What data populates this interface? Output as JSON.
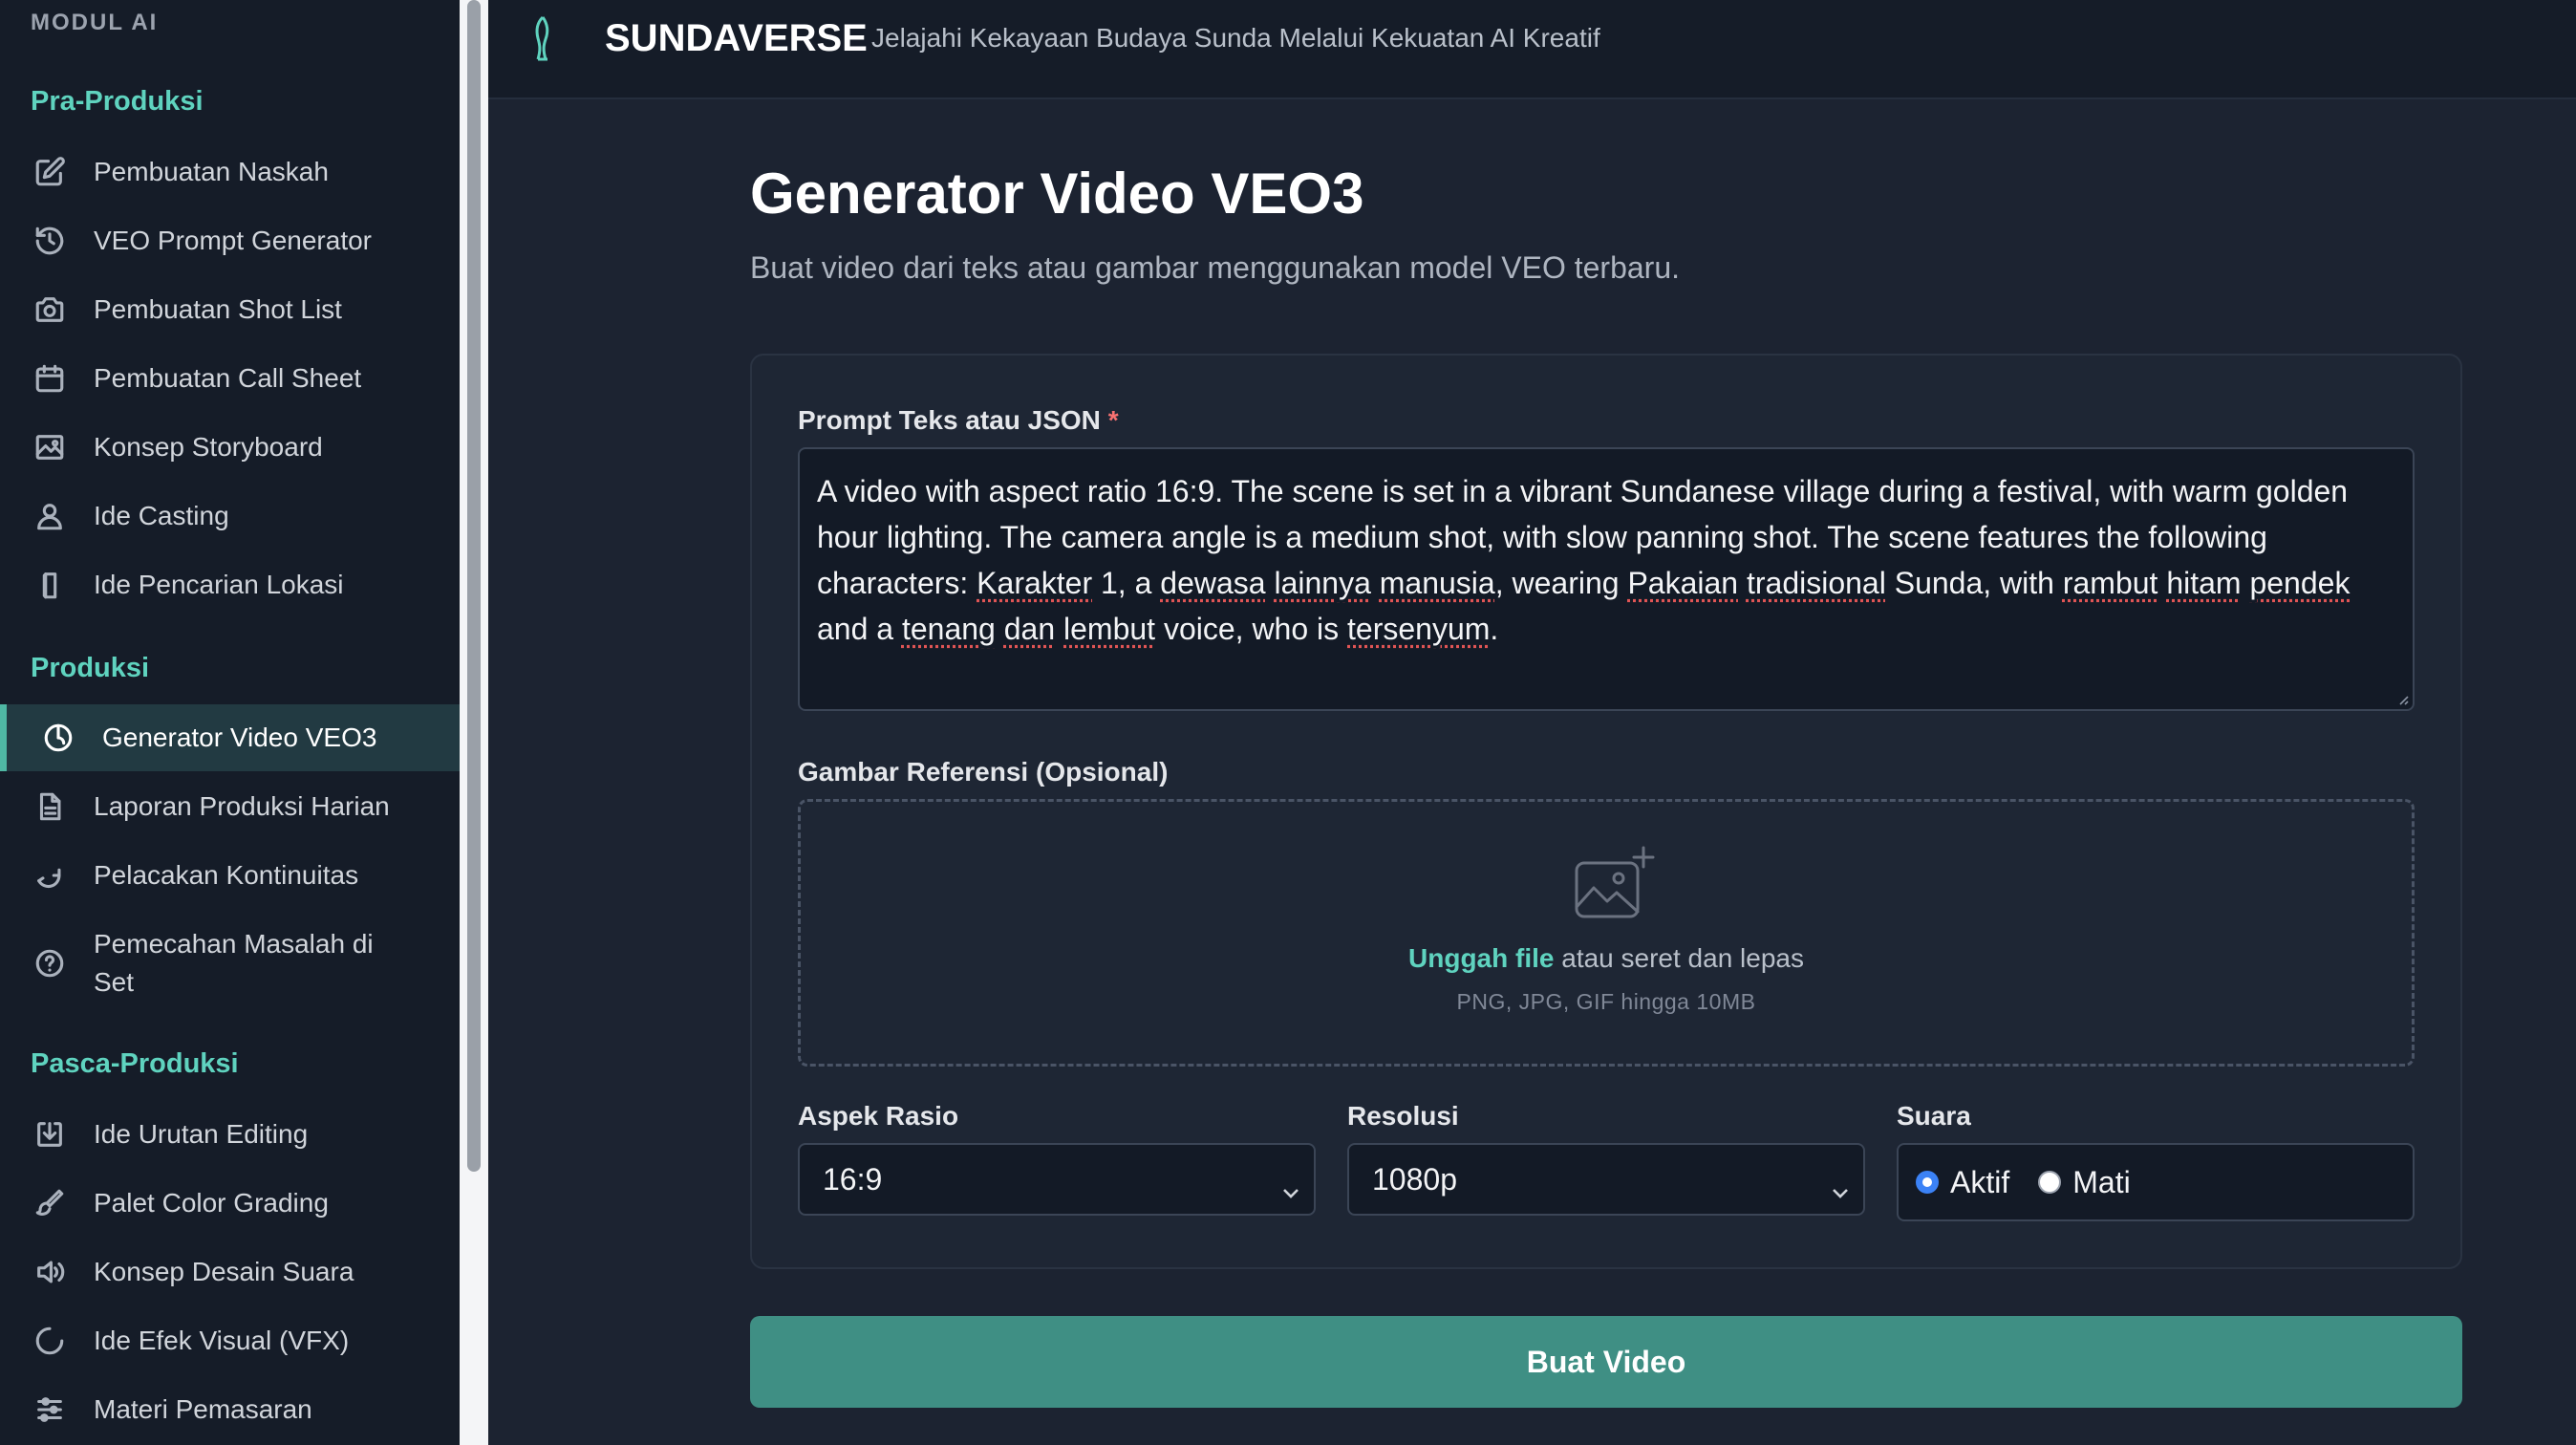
{
  "sidebar": {
    "modul_label": "MODUL AI",
    "sections": [
      {
        "title": "Pra-Produksi",
        "items": [
          {
            "label": "Pembuatan Naskah",
            "icon": "edit-icon"
          },
          {
            "label": "VEO Prompt Generator",
            "icon": "history-icon"
          },
          {
            "label": "Pembuatan Shot List",
            "icon": "camera-icon"
          },
          {
            "label": "Pembuatan Call Sheet",
            "icon": "calendar-icon"
          },
          {
            "label": "Konsep Storyboard",
            "icon": "image-icon"
          },
          {
            "label": "Ide Casting",
            "icon": "user-icon"
          },
          {
            "label": "Ide Pencarian Lokasi",
            "icon": "door-icon"
          }
        ]
      },
      {
        "title": "Produksi",
        "items": [
          {
            "label": "Generator Video VEO3",
            "icon": "power-icon",
            "active": true
          },
          {
            "label": "Laporan Produksi Harian",
            "icon": "document-icon"
          },
          {
            "label": "Pelacakan Kontinuitas",
            "icon": "return-arrow-icon"
          },
          {
            "label": "Pemecahan Masalah di Set",
            "icon": "help-circle-icon"
          }
        ]
      },
      {
        "title": "Pasca-Produksi",
        "items": [
          {
            "label": "Ide Urutan Editing",
            "icon": "import-icon"
          },
          {
            "label": "Palet Color Grading",
            "icon": "brush-icon"
          },
          {
            "label": "Konsep Desain Suara",
            "icon": "speaker-icon"
          },
          {
            "label": "Ide Efek Visual (VFX)",
            "icon": "spinner-circle-icon"
          },
          {
            "label": "Materi Pemasaran",
            "icon": "sliders-icon"
          }
        ]
      }
    ]
  },
  "header": {
    "brand": "SUNDAVERSE",
    "tagline": "Jelajahi Kekayaan Budaya Sunda Melalui Kekuatan AI Kreatif",
    "logo_icon": "kujang-logo-icon"
  },
  "main": {
    "title": "Generator Video VEO3",
    "subtitle": "Buat video dari teks atau gambar menggunakan model VEO terbaru.",
    "prompt": {
      "label": "Prompt Teks atau JSON",
      "required_mark": "*",
      "value_segments": [
        "A video with aspect ratio 16:9. The scene is set in a vibrant Sundanese village during a festival, with warm golden hour lighting. The camera angle is a medium shot, with slow panning shot. The scene features the following characters: ",
        "Karakter",
        " 1, a ",
        "dewasa",
        " ",
        "lainnya",
        " ",
        "manusia",
        ", wearing ",
        "Pakaian",
        " ",
        "tradisional",
        " Sunda, with ",
        "rambut",
        " ",
        "hitam",
        " ",
        "pendek",
        " and a ",
        "tenang",
        " ",
        "dan",
        " ",
        "lembut",
        " voice, who is ",
        "tersenyum",
        "."
      ]
    },
    "reference_image": {
      "label": "Gambar Referensi (Opsional)",
      "upload_link": "Unggah file",
      "upload_rest": " atau seret dan lepas",
      "hint": "PNG, JPG, GIF hingga 10MB",
      "icon": "image-plus-icon"
    },
    "aspect_ratio": {
      "label": "Aspek Rasio",
      "value": "16:9"
    },
    "resolution": {
      "label": "Resolusi",
      "value": "1080p"
    },
    "sound": {
      "label": "Suara",
      "options": [
        "Aktif",
        "Mati"
      ],
      "selected": "Aktif"
    },
    "submit_label": "Buat Video"
  },
  "colors": {
    "accent": "#5fd3bf",
    "button": "#3f8f84",
    "sidebar_bg": "#151c28",
    "main_bg": "#1c2331",
    "required": "#f87171",
    "radio": "#3b82f6"
  }
}
